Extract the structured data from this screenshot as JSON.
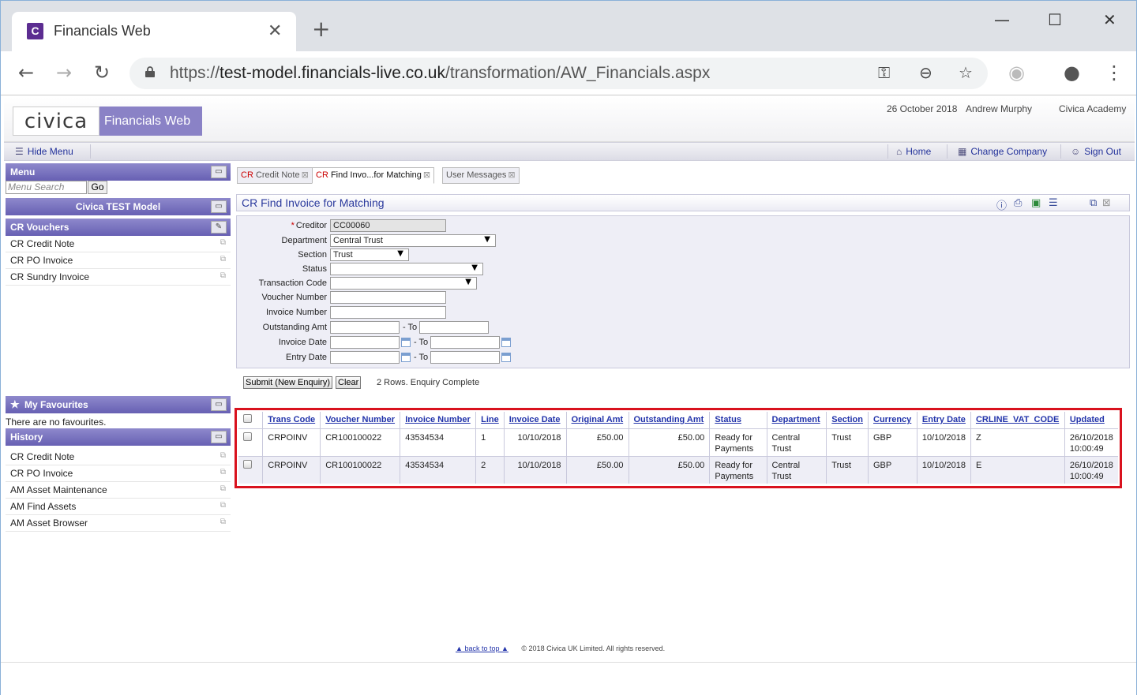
{
  "browser": {
    "tab_title": "Financials Web",
    "favicon_letter": "C",
    "url_scheme": "https://",
    "url_host": "test-model.financials-live.co.uk",
    "url_path": "/transformation/AW_Financials.aspx"
  },
  "header": {
    "logo": "civica",
    "app_name": "Financials Web",
    "date": "26 October 2018",
    "user": "Andrew Murphy",
    "company": "Civica Academy"
  },
  "toolbar": {
    "hide_menu": "Hide Menu",
    "home": "Home",
    "change_company": "Change Company",
    "sign_out": "Sign Out"
  },
  "sidebar": {
    "menu_title": "Menu",
    "search_placeholder": "Menu Search",
    "go_label": "Go",
    "model_title": "Civica TEST Model",
    "vouchers_title": "CR Vouchers",
    "vouchers_items": [
      "CR Credit Note",
      "CR PO Invoice",
      "CR Sundry Invoice"
    ],
    "favourites_title": "My Favourites",
    "favourites_empty": "There are no favourites.",
    "history_title": "History",
    "history_items": [
      "CR Credit Note",
      "CR PO Invoice",
      "AM Asset Maintenance",
      "AM Find Assets",
      "AM Asset Browser"
    ]
  },
  "content_tabs": {
    "tab1_prefix": "CR",
    "tab1_rest": "Credit Note",
    "tab2_prefix": "CR",
    "tab2_rest": "Find Invo...for Matching",
    "tab3": "User Messages"
  },
  "panel": {
    "title": "CR Find Invoice for Matching"
  },
  "form": {
    "creditor_label": "Creditor",
    "creditor_value": "CC00060",
    "department_label": "Department",
    "department_value": "Central Trust",
    "section_label": "Section",
    "section_value": "Trust",
    "status_label": "Status",
    "transaction_code_label": "Transaction Code",
    "voucher_number_label": "Voucher Number",
    "invoice_number_label": "Invoice Number",
    "outstanding_amt_label": "Outstanding Amt",
    "invoice_date_label": "Invoice Date",
    "entry_date_label": "Entry Date",
    "to_label": "- To"
  },
  "actions": {
    "submit": "Submit (New Enquiry)",
    "clear": "Clear",
    "status": "2 Rows. Enquiry Complete"
  },
  "results": {
    "columns": [
      "Trans Code",
      "Voucher Number",
      "Invoice Number",
      "Line",
      "Invoice Date",
      "Original Amt",
      "Outstanding Amt",
      "Status",
      "Department",
      "Section",
      "Currency",
      "Entry Date",
      "CRLINE_VAT_CODE",
      "Updated"
    ],
    "rows": [
      {
        "trans_code": "CRPOINV",
        "voucher_number": "CR100100022",
        "invoice_number": "43534534",
        "line": "1",
        "invoice_date": "10/10/2018",
        "original_amt": "£50.00",
        "outstanding_amt": "£50.00",
        "status_l1": "Ready for",
        "status_l2": "Payments",
        "department_l1": "Central",
        "department_l2": "Trust",
        "section": "Trust",
        "currency": "GBP",
        "entry_date": "10/10/2018",
        "vat_code": "Z",
        "updated_l1": "26/10/2018",
        "updated_l2": "10:00:49"
      },
      {
        "trans_code": "CRPOINV",
        "voucher_number": "CR100100022",
        "invoice_number": "43534534",
        "line": "2",
        "invoice_date": "10/10/2018",
        "original_amt": "£50.00",
        "outstanding_amt": "£50.00",
        "status_l1": "Ready for",
        "status_l2": "Payments",
        "department_l1": "Central",
        "department_l2": "Trust",
        "section": "Trust",
        "currency": "GBP",
        "entry_date": "10/10/2018",
        "vat_code": "E",
        "updated_l1": "26/10/2018",
        "updated_l2": "10:00:49"
      }
    ]
  },
  "footer": {
    "back_to_top": "back to top",
    "copyright": "© 2018 Civica UK Limited. All rights reserved."
  },
  "colors": {
    "accent": "#6760b3",
    "link": "#2233aa",
    "highlight": "#d9121e"
  }
}
